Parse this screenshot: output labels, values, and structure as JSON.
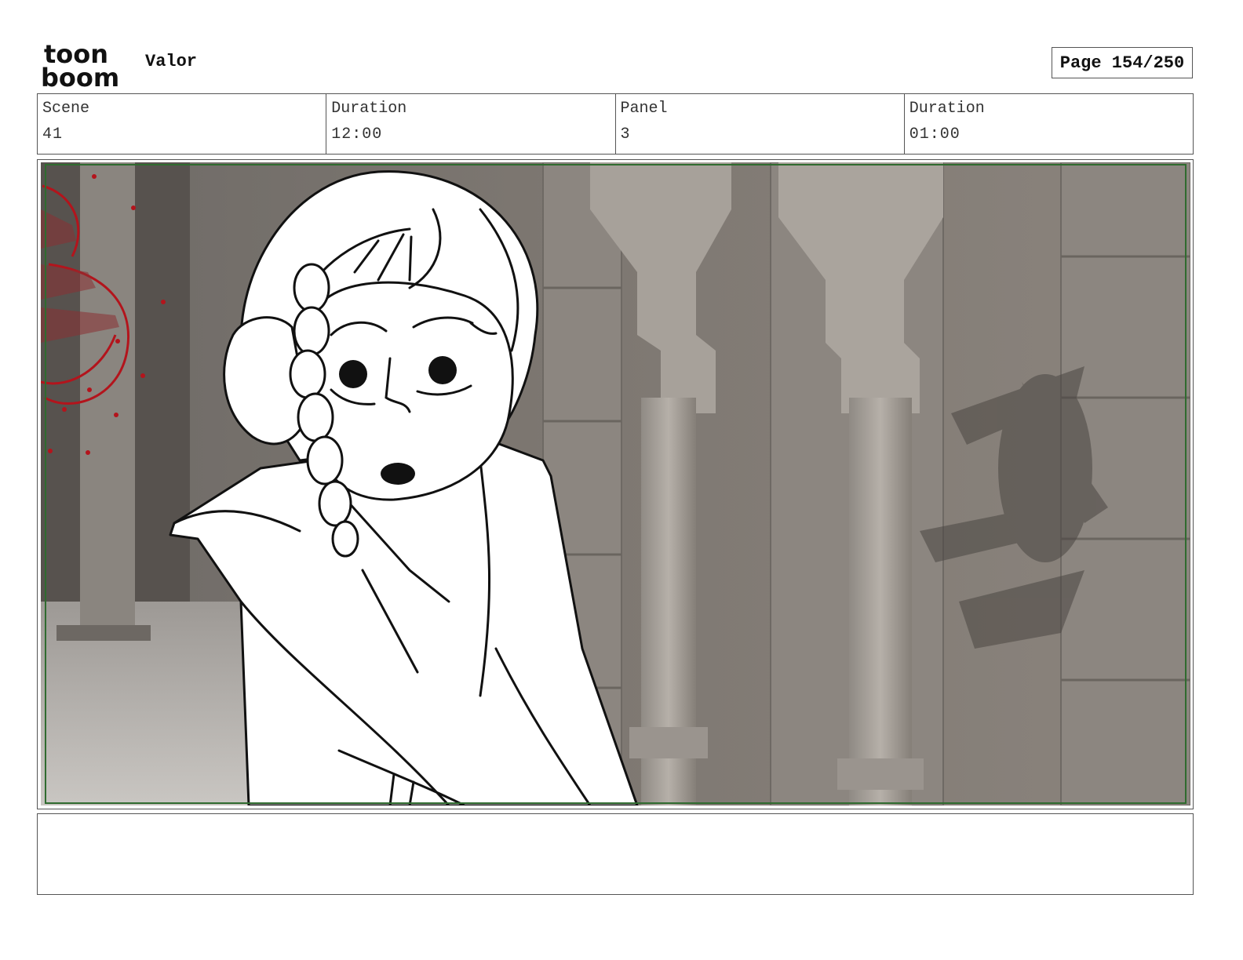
{
  "header": {
    "logo": {
      "line1": "toon",
      "line2": "boom"
    },
    "project_title": "Valor",
    "page_indicator": "Page 154/250"
  },
  "info": {
    "scene_label": "Scene",
    "scene_value": "41",
    "scene_duration_label": "Duration",
    "scene_duration_value": "12:00",
    "panel_label": "Panel",
    "panel_value": "3",
    "panel_duration_label": "Duration",
    "panel_duration_value": "01:00"
  },
  "panel": {
    "frame_border_color": "#2f6b2f",
    "sketch_accent_color": "#b3141c"
  },
  "notes": {
    "text": ""
  }
}
